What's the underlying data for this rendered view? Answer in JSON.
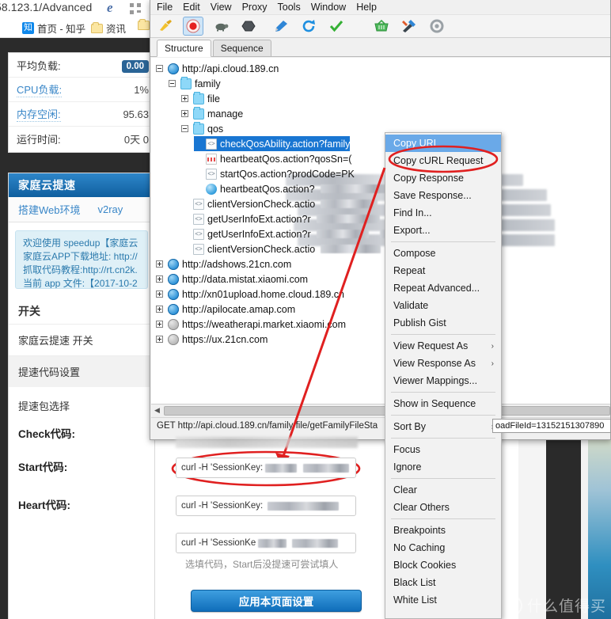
{
  "browser": {
    "url_text": "58.123.1/Advanced",
    "bookmarks": [
      {
        "label": "首页 - 知乎",
        "icon": "zhihu-badge",
        "badge": "知"
      },
      {
        "label": "资讯",
        "icon": "folder-icon"
      },
      {
        "label": "",
        "icon": "folder-icon"
      }
    ]
  },
  "status_panel": {
    "rows": [
      {
        "label": "平均负载:",
        "value": "0.00",
        "style": "badge",
        "link": false
      },
      {
        "label": "CPU负载:",
        "value": "1%",
        "style": "text",
        "link": true
      },
      {
        "label": "内存空闲:",
        "value": "95.63",
        "style": "text",
        "link": true
      },
      {
        "label": "运行时间:",
        "value": "0天 0",
        "style": "text",
        "link": false
      }
    ]
  },
  "speed_panel": {
    "title": "家庭云提速",
    "tabs": [
      "搭建Web环境",
      "v2ray"
    ],
    "alert_lines": [
      "欢迎使用 speedup【家庭云",
      "家庭云APP下载地址: http://",
      "抓取代码教程:http://rt.cn2k.",
      "当前 app 文件:【2017-10-2"
    ],
    "switch_title": "开关",
    "switch_row": "家庭云提速 开关",
    "code_settings_row": "提速代码设置",
    "package_row": "提速包选择",
    "fields": [
      {
        "label": "Check代码:",
        "value": "curl -H 'SessionKey:",
        "redacted": true
      },
      {
        "label": "Start代码:",
        "value": "curl -H 'SessionKey:",
        "redacted": true
      },
      {
        "label": "Heart代码:",
        "value": "curl -H 'SessionKe",
        "redacted": true
      }
    ],
    "hint": "选填代码，Start后没提速可尝试填人",
    "apply_button": "应用本页面设置"
  },
  "charles": {
    "menubar": [
      "File",
      "Edit",
      "View",
      "Proxy",
      "Tools",
      "Window",
      "Help"
    ],
    "toolbar_icons": [
      {
        "name": "clear-broom-icon",
        "active": false
      },
      {
        "name": "record-icon",
        "active": true
      },
      {
        "name": "throttle-turtle-icon",
        "active": false
      },
      {
        "name": "breakpoint-hexagon-icon",
        "active": false
      },
      {
        "name": "compose-pen-icon",
        "active": false
      },
      {
        "name": "repeat-refresh-icon",
        "active": false
      },
      {
        "name": "validate-check-icon",
        "active": false
      },
      {
        "name": "tools-basket-icon",
        "active": false
      },
      {
        "name": "tools-wrench-icon",
        "active": false
      },
      {
        "name": "settings-gear-icon",
        "active": false
      }
    ],
    "tabs": [
      {
        "label": "Structure",
        "selected": true
      },
      {
        "label": "Sequence",
        "selected": false
      }
    ],
    "tree": [
      {
        "indent": 0,
        "expander": "minus",
        "icon": "globe-icon",
        "label": "http://api.cloud.189.cn",
        "selected": false
      },
      {
        "indent": 1,
        "expander": "minus",
        "icon": "folder-icon",
        "label": "family",
        "selected": false
      },
      {
        "indent": 2,
        "expander": "plus",
        "icon": "folder-icon",
        "label": "file",
        "selected": false
      },
      {
        "indent": 2,
        "expander": "plus",
        "icon": "folder-icon",
        "label": "manage",
        "selected": false
      },
      {
        "indent": 2,
        "expander": "minus",
        "icon": "folder-icon",
        "label": "qos",
        "selected": false
      },
      {
        "indent": 3,
        "expander": "none",
        "icon": "code-icon",
        "label": "checkQosAbility.action?family",
        "selected": true
      },
      {
        "indent": 3,
        "expander": "none",
        "icon": "doc-icon",
        "label": "heartbeatQos.action?qosSn=(",
        "selected": false
      },
      {
        "indent": 3,
        "expander": "none",
        "icon": "code-icon",
        "label": "startQos.action?prodCode=PK",
        "selected": false
      },
      {
        "indent": 3,
        "expander": "none",
        "icon": "json-icon",
        "label": "heartbeatQos.action?",
        "selected": false,
        "redacted": true
      },
      {
        "indent": 2,
        "expander": "none",
        "icon": "code-icon",
        "label": "clientVersionCheck.actio",
        "selected": false,
        "redacted": true
      },
      {
        "indent": 2,
        "expander": "none",
        "icon": "code-icon",
        "label": "getUserInfoExt.action?r",
        "selected": false,
        "redacted": true
      },
      {
        "indent": 2,
        "expander": "none",
        "icon": "code-icon",
        "label": "getUserInfoExt.action?r",
        "selected": false,
        "redacted": true
      },
      {
        "indent": 2,
        "expander": "none",
        "icon": "code-icon",
        "label": "clientVersionCheck.actio",
        "selected": false,
        "redacted": true
      },
      {
        "indent": 0,
        "expander": "plus",
        "icon": "globe-icon",
        "label": "http://adshows.21cn.com",
        "selected": false
      },
      {
        "indent": 0,
        "expander": "plus",
        "icon": "globe-icon",
        "label": "http://data.mistat.xiaomi.com",
        "selected": false
      },
      {
        "indent": 0,
        "expander": "plus",
        "icon": "globe-icon",
        "label": "http://xn01upload.home.cloud.189.cn",
        "selected": false
      },
      {
        "indent": 0,
        "expander": "plus",
        "icon": "globe-icon",
        "label": "http://apilocate.amap.com",
        "selected": false
      },
      {
        "indent": 0,
        "expander": "plus",
        "icon": "lock-icon",
        "label": "https://weatherapi.market.xiaomi.com",
        "selected": false
      },
      {
        "indent": 0,
        "expander": "plus",
        "icon": "lock-icon",
        "label": "https://ux.21cn.com",
        "selected": false
      }
    ],
    "statusbar": "GET http://api.cloud.189.cn/family/file/getFamilyFileSta"
  },
  "context_menu": {
    "groups": [
      [
        {
          "label": "Copy URL",
          "highlighted": true
        },
        {
          "label": "Copy cURL Request"
        },
        {
          "label": "Copy Response"
        },
        {
          "label": "Save Response..."
        },
        {
          "label": "Find In..."
        },
        {
          "label": "Export..."
        }
      ],
      [
        {
          "label": "Compose"
        },
        {
          "label": "Repeat"
        },
        {
          "label": "Repeat Advanced..."
        },
        {
          "label": "Validate"
        },
        {
          "label": "Publish Gist"
        }
      ],
      [
        {
          "label": "View Request As",
          "submenu": true
        },
        {
          "label": "View Response As",
          "submenu": true
        },
        {
          "label": "Viewer Mappings..."
        }
      ],
      [
        {
          "label": "Show in Sequence"
        }
      ],
      [
        {
          "label": "Sort By",
          "submenu": true
        }
      ],
      [
        {
          "label": "Focus"
        },
        {
          "label": "Ignore"
        }
      ],
      [
        {
          "label": "Clear"
        },
        {
          "label": "Clear Others"
        }
      ],
      [
        {
          "label": "Breakpoints"
        },
        {
          "label": "No Caching"
        },
        {
          "label": "Block Cookies"
        },
        {
          "label": "Black List"
        },
        {
          "label": "White List"
        }
      ]
    ]
  },
  "tooltip": {
    "url_fragment": "oadFileId=13152151307890"
  },
  "watermark": {
    "badge": "值",
    "text": "什么值得买"
  },
  "colors": {
    "accent_blue": "#1976d2",
    "panel_header_blue": "#1a6fb5",
    "annotation_red": "#e02020",
    "menu_highlight": "#6aa9e8"
  }
}
